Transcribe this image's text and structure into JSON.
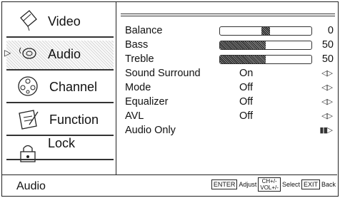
{
  "sidebar": {
    "items": [
      {
        "label": "Video",
        "icon": "video-icon"
      },
      {
        "label": "Audio",
        "icon": "audio-icon",
        "selected": true
      },
      {
        "label": "Channel",
        "icon": "channel-icon"
      },
      {
        "label": "Function",
        "icon": "function-icon"
      },
      {
        "label": "Lock",
        "icon": "lock-icon"
      }
    ]
  },
  "settings": {
    "balance": {
      "label": "Balance",
      "value": "0",
      "level": 0
    },
    "bass": {
      "label": "Bass",
      "value": "50",
      "level": 0.5
    },
    "treble": {
      "label": "Treble",
      "value": "50",
      "level": 0.5
    },
    "sound_surround": {
      "label": "Sound Surround",
      "value": "On"
    },
    "mode": {
      "label": "Mode",
      "value": "Off"
    },
    "equalizer": {
      "label": "Equalizer",
      "value": "Off"
    },
    "avl": {
      "label": "AVL",
      "value": "Off"
    },
    "audio_only": {
      "label": "Audio Only"
    }
  },
  "footer": {
    "title": "Audio",
    "enter_key": "ENTER",
    "adjust_label": "Adjust",
    "ch_key": "CH+/-",
    "vol_key": "VOL+/-",
    "select_label": "Select",
    "exit_key": "EXIT",
    "back_label": "Back"
  }
}
